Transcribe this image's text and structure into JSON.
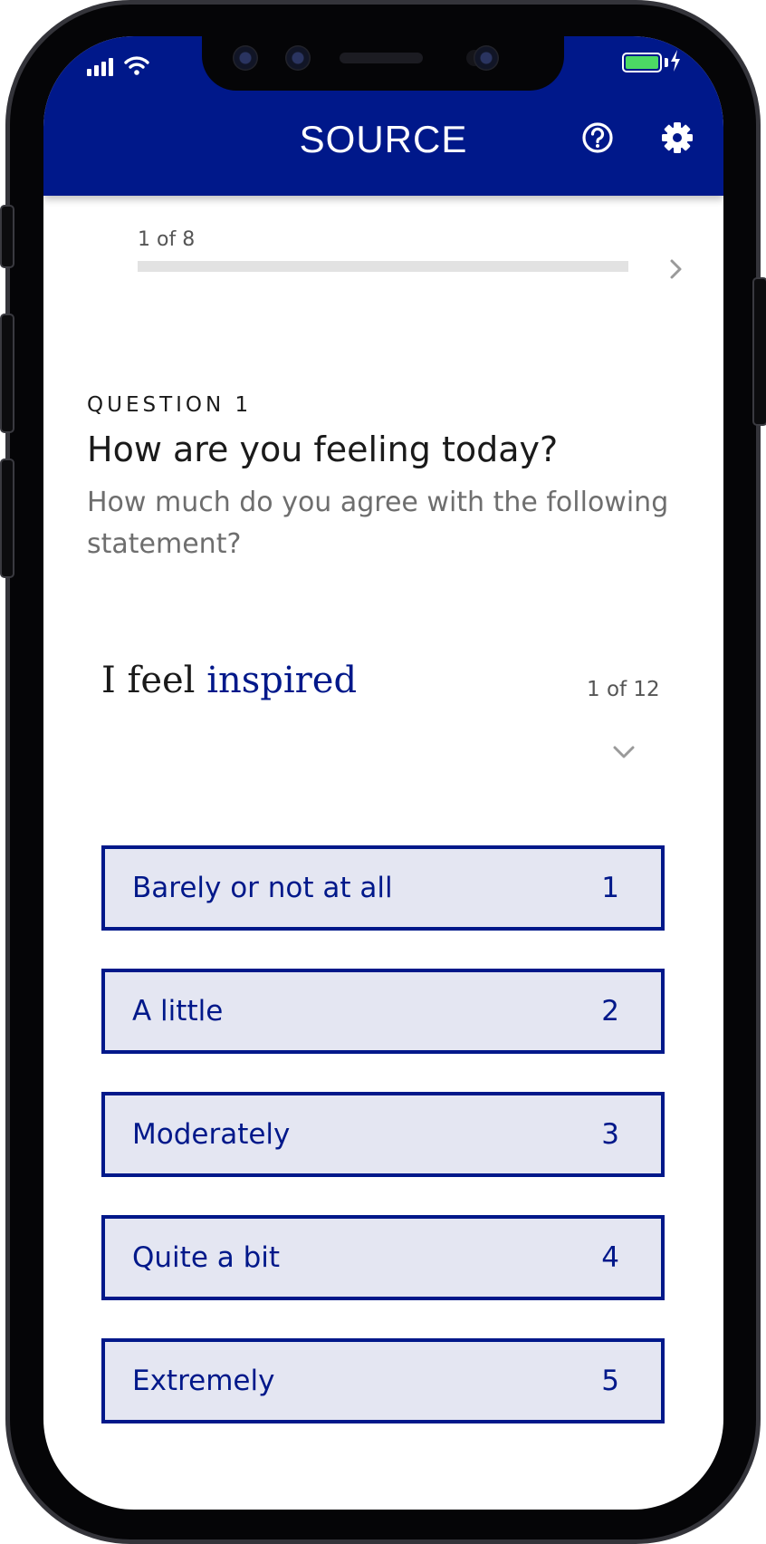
{
  "app": {
    "brand": "SOURCE",
    "accent_color": "#00188a",
    "icons": {
      "help": "help-circle-icon",
      "settings": "gear-icon",
      "next": "chevron-right-icon",
      "expand": "chevron-down-icon"
    }
  },
  "progress": {
    "label": "1 of 8",
    "current": 1,
    "total": 8
  },
  "question": {
    "number_label": "QUESTION 1",
    "title": "How are you feeling today?",
    "subtitle": "How much do you agree with the following statement?"
  },
  "statement": {
    "prefix": "I feel",
    "emphasis": "inspired",
    "count_label": "1 of 12"
  },
  "options": [
    {
      "label": "Barely or not at all",
      "value": "1"
    },
    {
      "label": "A little",
      "value": "2"
    },
    {
      "label": "Moderately",
      "value": "3"
    },
    {
      "label": "Quite a bit",
      "value": "4"
    },
    {
      "label": "Extremely",
      "value": "5"
    }
  ]
}
